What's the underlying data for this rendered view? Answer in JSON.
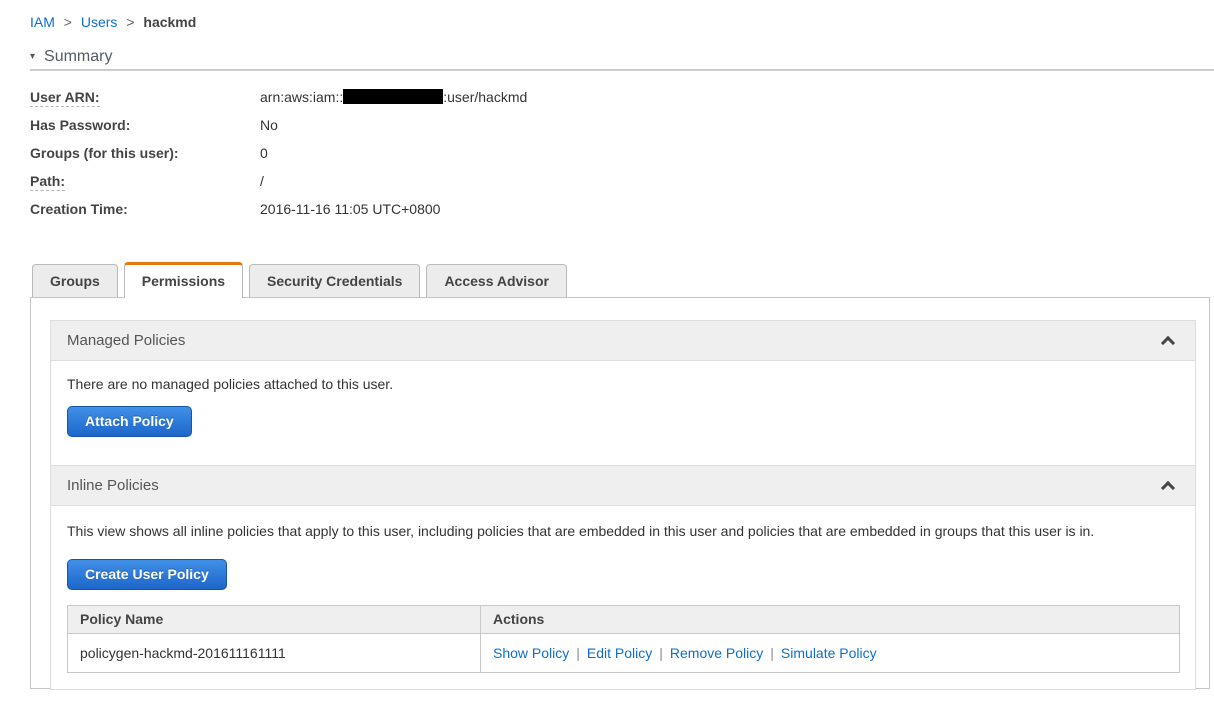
{
  "breadcrumb": {
    "separator": ">",
    "items": [
      {
        "label": "IAM"
      },
      {
        "label": "Users"
      },
      {
        "label": "hackmd"
      }
    ]
  },
  "summary": {
    "disclosure_icon": "▾",
    "title": "Summary",
    "fields": [
      {
        "label": "User ARN:",
        "value_prefix": "arn:aws:iam::",
        "value_suffix": ":user/hackmd",
        "redacted": true
      },
      {
        "label": "Has Password:",
        "value": "No"
      },
      {
        "label": "Groups (for this user):",
        "value": "0"
      },
      {
        "label": "Path:",
        "value": "/"
      },
      {
        "label": "Creation Time:",
        "value": "2016-11-16 11:05 UTC+0800"
      }
    ]
  },
  "tabs": [
    {
      "label": "Groups",
      "active": false
    },
    {
      "label": "Permissions",
      "active": true
    },
    {
      "label": "Security Credentials",
      "active": false
    },
    {
      "label": "Access Advisor",
      "active": false
    }
  ],
  "managed_policies": {
    "title": "Managed Policies",
    "empty_text": "There are no managed policies attached to this user.",
    "attach_button_label": "Attach Policy"
  },
  "inline_policies": {
    "title": "Inline Policies",
    "description": "This view shows all inline policies that apply to this user, including policies that are embedded in this user and policies that are embedded in groups that this user is in.",
    "create_button_label": "Create User Policy",
    "table": {
      "headers": [
        "Policy Name",
        "Actions"
      ],
      "actions_separator": "|",
      "rows": [
        {
          "policy_name": "policygen-hackmd-201611161111",
          "actions": [
            "Show Policy",
            "Edit Policy",
            "Remove Policy",
            "Simulate Policy"
          ]
        }
      ]
    }
  },
  "colors": {
    "accent_orange": "#e47911",
    "link_blue": "#0d6ecd",
    "button_blue_top": "#4190e8",
    "button_blue_bottom": "#1d66c9",
    "section_header_bg": "#efefef",
    "redaction_black": "#000000"
  }
}
